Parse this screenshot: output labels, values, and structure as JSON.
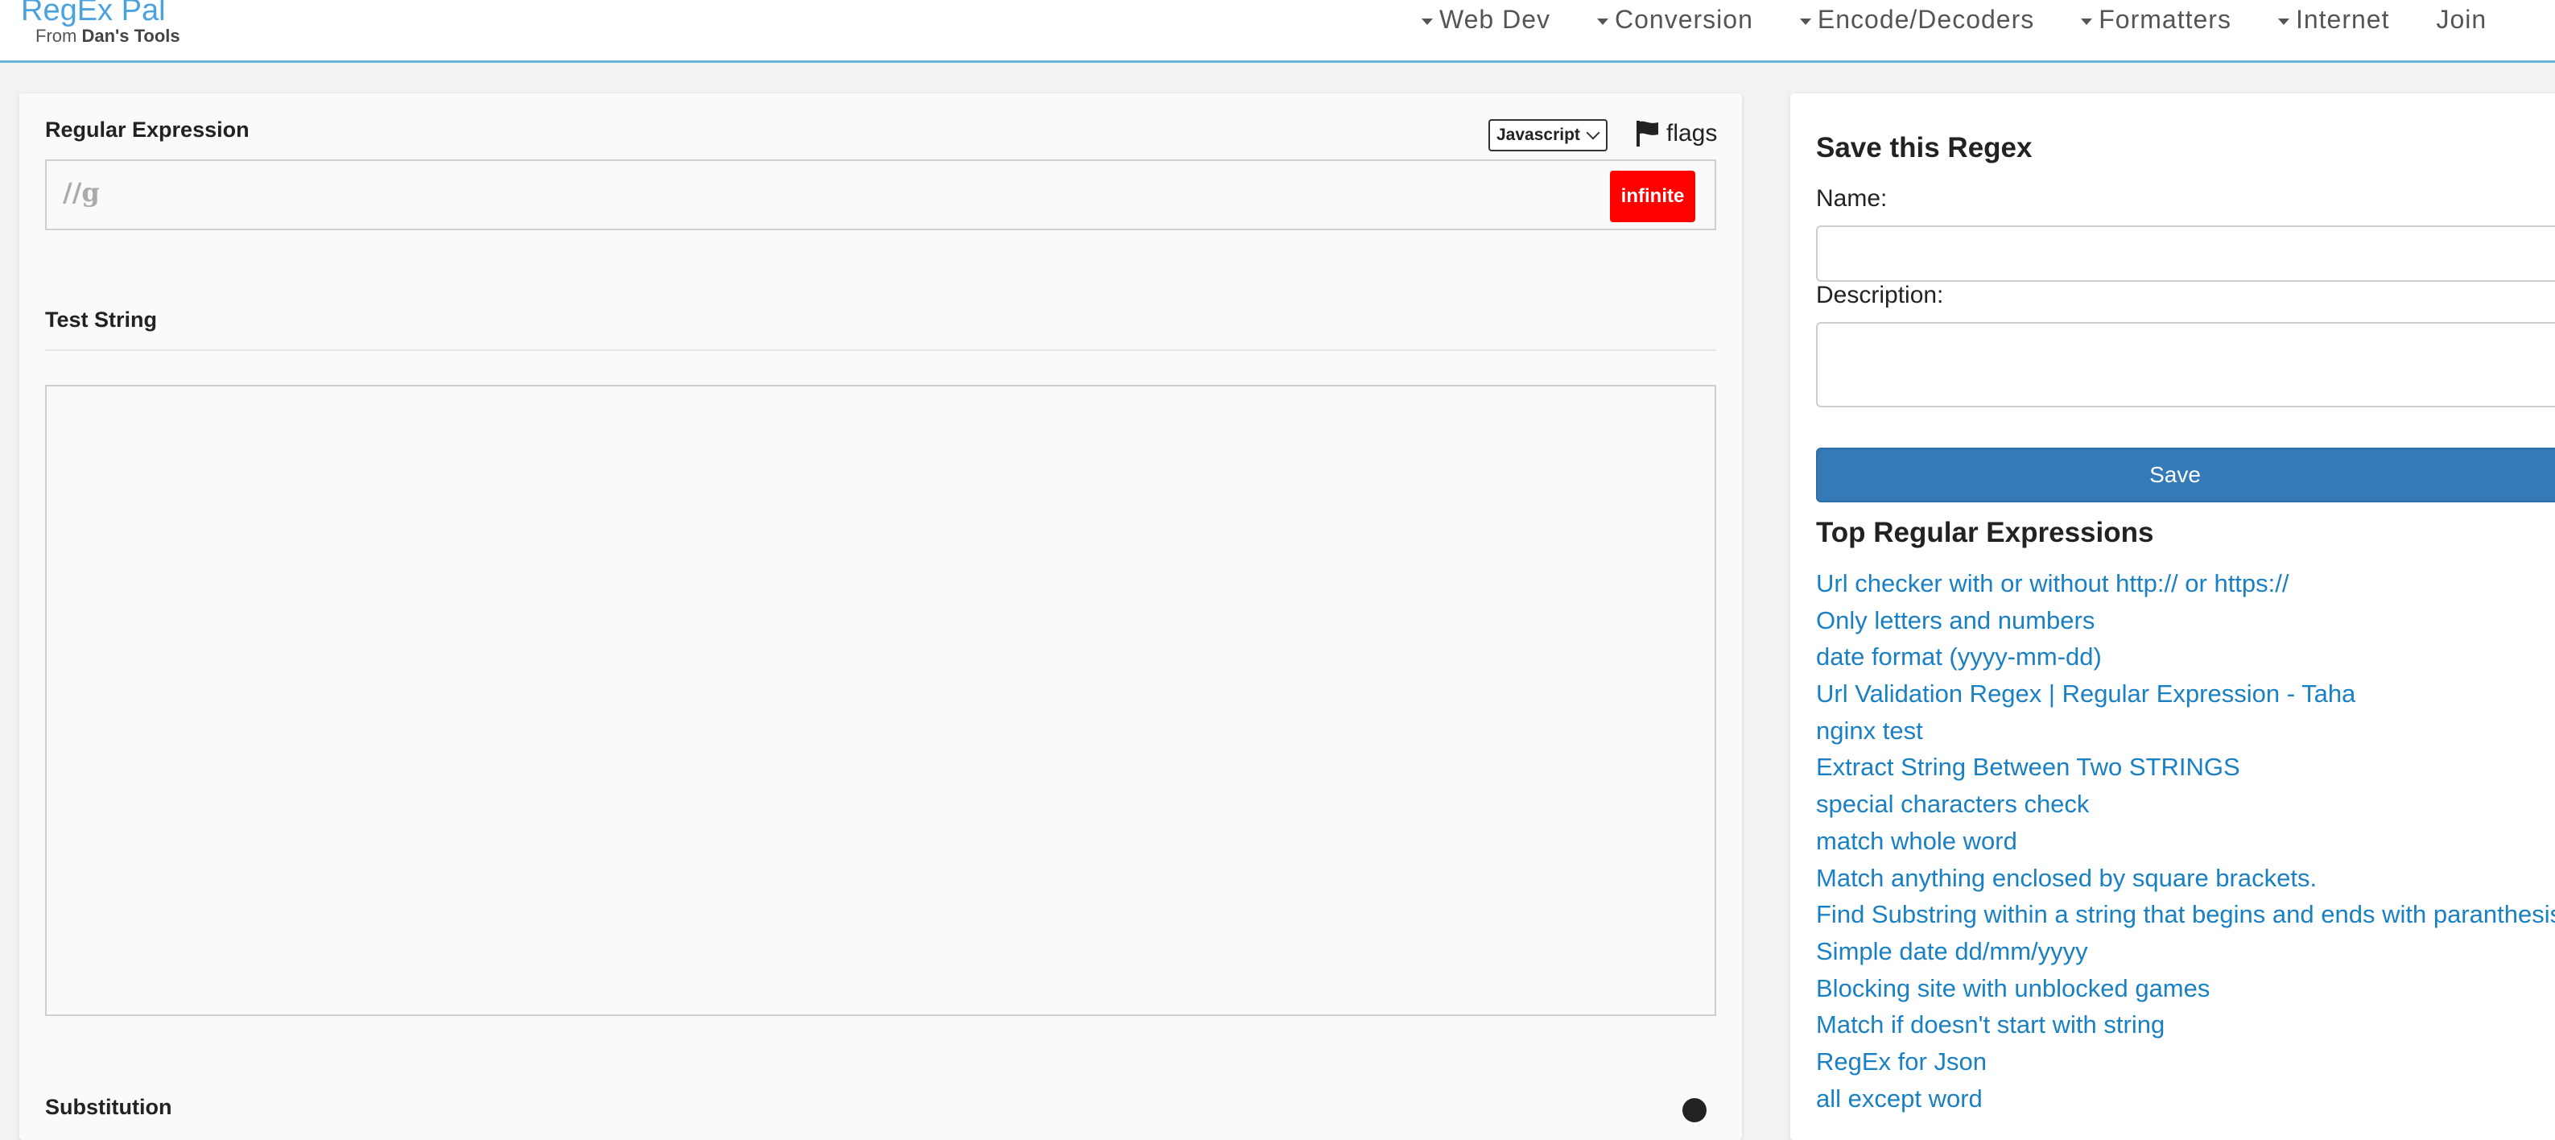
{
  "brand": {
    "title": "RegEx Pal",
    "sub_prefix": "From ",
    "sub_bold": "Dan's Tools"
  },
  "nav": [
    "Web Dev",
    "Conversion",
    "Encode/Decoders",
    "Formatters",
    "Internet"
  ],
  "nav_join": "Join",
  "editor": {
    "regex_label": "Regular Expression",
    "flavor": "Javascript",
    "flags_label": "flags",
    "regex_value": "//g",
    "badge": "infinite",
    "test_label": "Test String",
    "test_value": "",
    "substitution_label": "Substitution"
  },
  "save_panel": {
    "title": "Save this Regex",
    "name_label": "Name:",
    "description_label": "Description:",
    "save_button": "Save"
  },
  "top_regex": {
    "title": "Top Regular Expressions",
    "items": [
      "Url checker with or without http:// or https://",
      "Only letters and numbers",
      "date format (yyyy-mm-dd)",
      "Url Validation Regex | Regular Expression - Taha",
      "nginx test",
      "Extract String Between Two STRINGS",
      "special characters check",
      "match whole word",
      "Match anything enclosed by square brackets.",
      "Find Substring within a string that begins and ends with paranthesis",
      "Simple date dd/mm/yyyy",
      "Blocking site with unblocked games",
      "Match if doesn't start with string",
      "RegEx for Json",
      "all except word"
    ]
  },
  "colors": {
    "link": "#1a80c4",
    "brand": "#4aa3df",
    "save_button": "#337ab7",
    "infinite_badge": "#ff0000",
    "nav_border": "#6cb6dc"
  }
}
